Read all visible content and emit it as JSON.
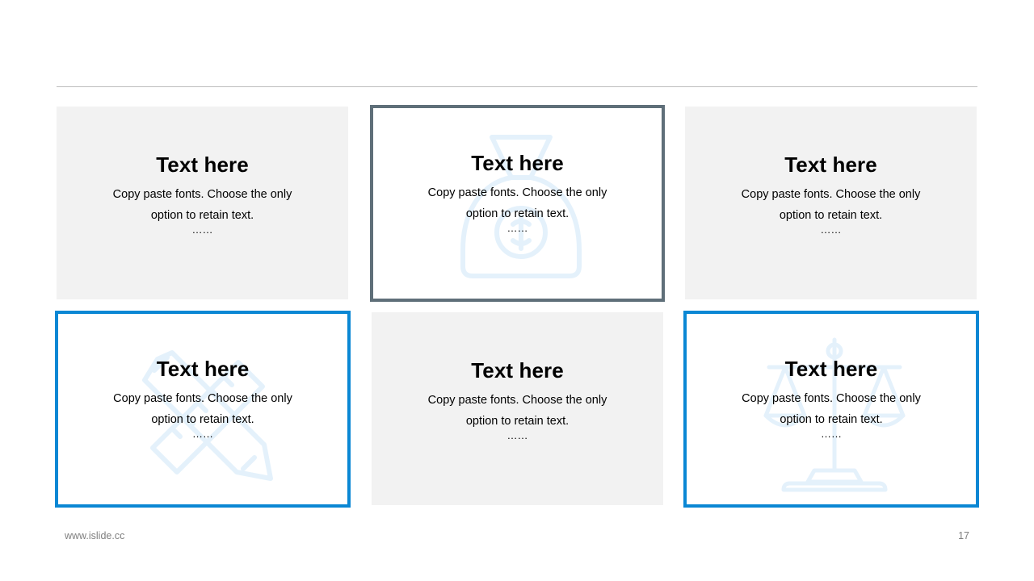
{
  "cards": [
    {
      "title": "Text here",
      "body_line1": "Copy paste fonts. Choose the only",
      "body_line2": "option to retain text.",
      "dots": "……"
    },
    {
      "title": "Text here",
      "body_line1": "Copy paste fonts. Choose the only",
      "body_line2": "option to retain text.",
      "dots": "……",
      "icon": "money-bag-icon"
    },
    {
      "title": "Text here",
      "body_line1": "Copy paste fonts. Choose the only",
      "body_line2": "option to retain text.",
      "dots": "……"
    },
    {
      "title": "Text here",
      "body_line1": "Copy paste fonts. Choose the only",
      "body_line2": "option to retain text.",
      "dots": "……",
      "icon": "ruler-pencil-icon"
    },
    {
      "title": "Text here",
      "body_line1": "Copy paste fonts. Choose the only",
      "body_line2": "option to retain text.",
      "dots": "……"
    },
    {
      "title": "Text here",
      "body_line1": "Copy paste fonts. Choose the only",
      "body_line2": "option to retain text.",
      "dots": "……",
      "icon": "scales-icon"
    }
  ],
  "footer": {
    "url": "www.islide.cc",
    "page_number": "17"
  },
  "colors": {
    "card_fill": "#f2f2f2",
    "slate_border": "#5f6f79",
    "blue_border": "#0a87d4",
    "watermark_icon": "#e4f1fb",
    "rule": "#bdbdbd",
    "footer_text": "#7f7f7f"
  }
}
